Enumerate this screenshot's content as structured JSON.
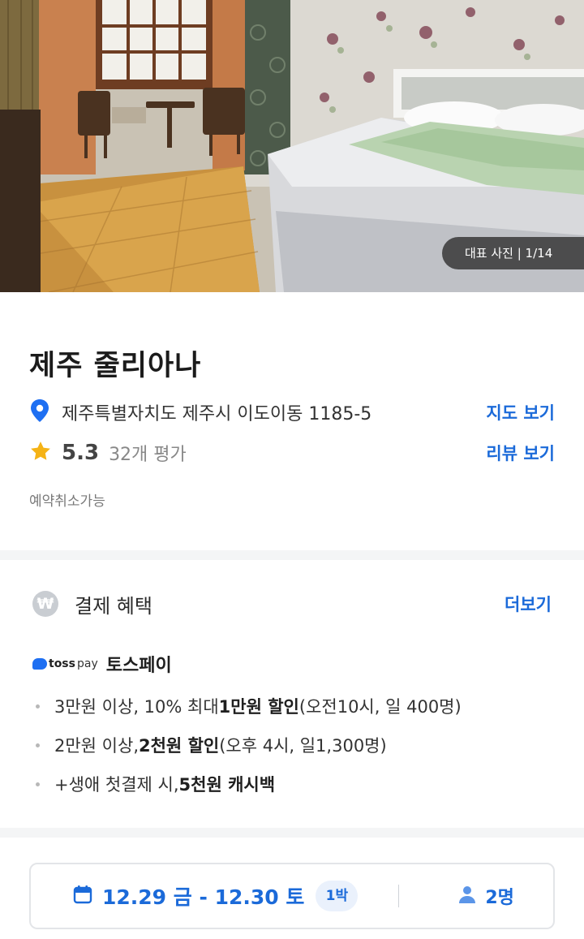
{
  "hero": {
    "badge": "대표 사진 | 1/14"
  },
  "hotel": {
    "name": "제주 줄리아나",
    "address": "제주특별자치도 제주시 이도이동 1185-5",
    "map_link": "지도 보기",
    "rating": "5.3",
    "review_count": "32개 평가",
    "review_link": "리뷰 보기",
    "cancel_note": "예약취소가능"
  },
  "benefits": {
    "icon_symbol": "₩",
    "title": "결제 혜택",
    "more_link": "더보기",
    "provider_logo": "toss",
    "provider_logo_suffix": "pay",
    "provider_name": "토스페이",
    "items": [
      {
        "pre": "3만원 이상, 10% 최대 ",
        "bold": "1만원 할인",
        "post": "(오전10시, 일 400명)"
      },
      {
        "pre": "2만원 이상, ",
        "bold": "2천원 할인",
        "post": " (오후 4시, 일1,300명)"
      },
      {
        "pre": "+생애 첫결제 시, ",
        "bold": "5천원 캐시백",
        "post": ""
      }
    ]
  },
  "booking": {
    "dates": "12.29 금 - 12.30 토",
    "nights": "1박",
    "guests": "2명"
  },
  "colors": {
    "accent": "#1b6ad9",
    "pin": "#1e6ff2",
    "star": "#f5b316",
    "divider": "#f4f5f6"
  },
  "icons": {
    "location": "location-pin-icon",
    "star": "star-icon",
    "won": "won-coin-icon",
    "calendar": "calendar-icon",
    "person": "person-icon"
  }
}
